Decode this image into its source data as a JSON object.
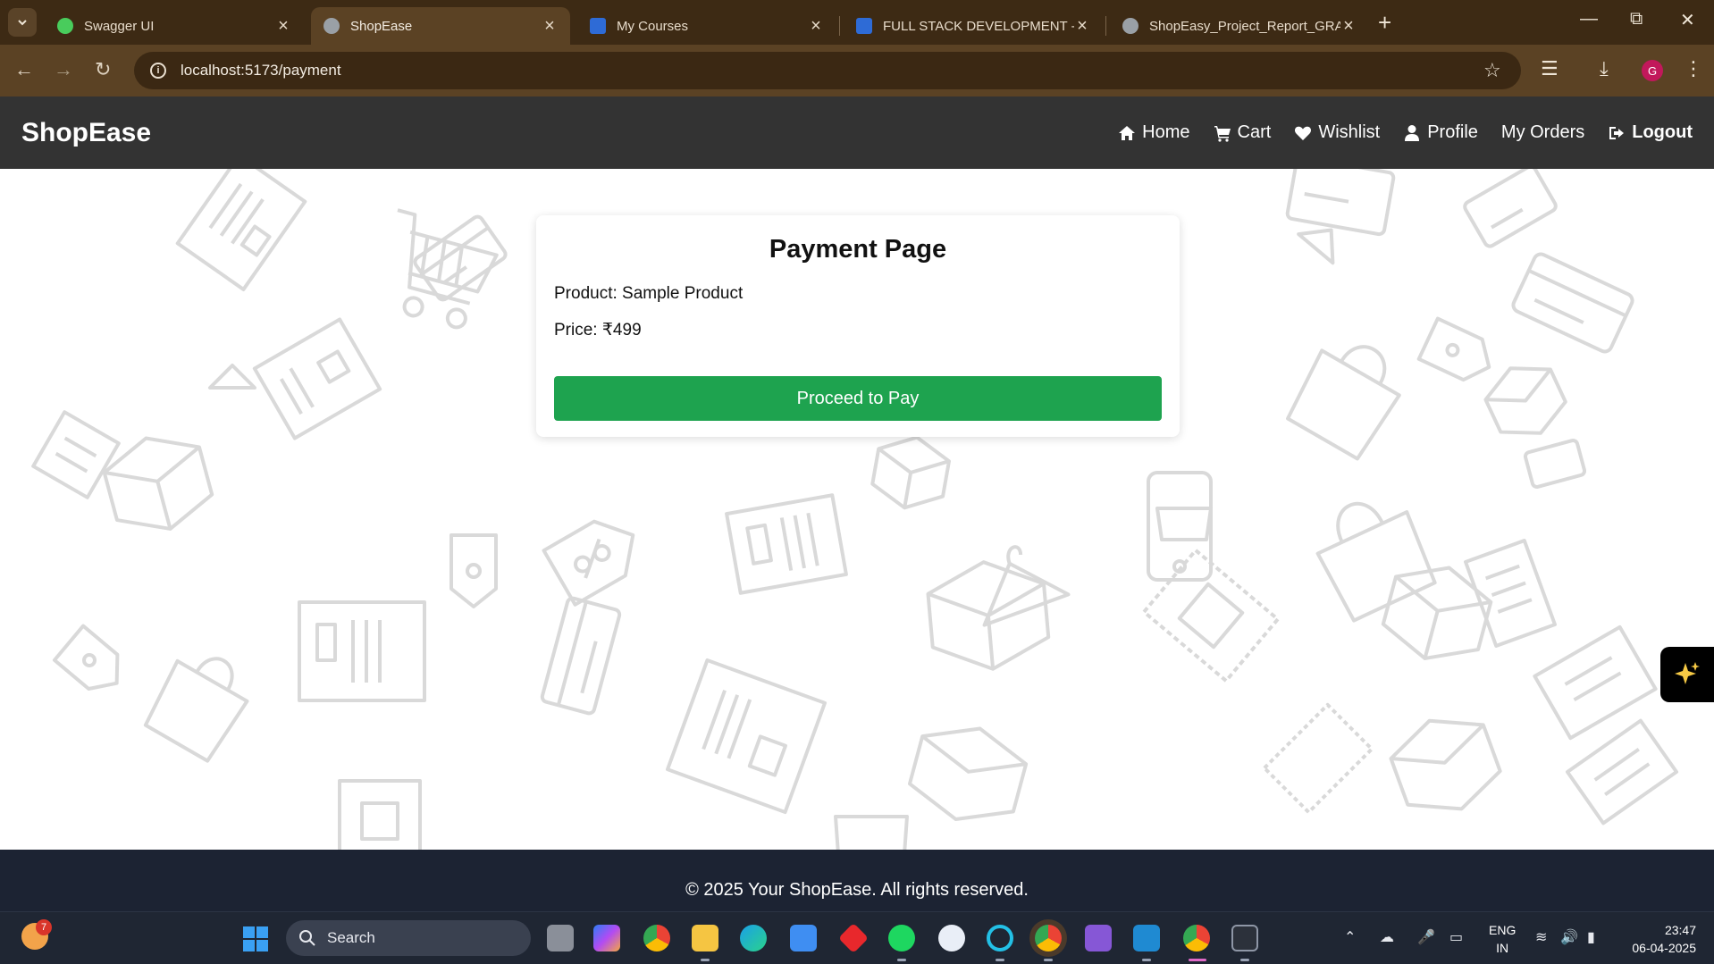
{
  "browser": {
    "tabs": [
      {
        "title": "Swagger UI",
        "active": false,
        "favicon_color": "#49cc5c"
      },
      {
        "title": "ShopEase",
        "active": true,
        "favicon_color": "#9aa0a6"
      },
      {
        "title": "My Courses",
        "active": false,
        "favicon_color": "#2e6bd6"
      },
      {
        "title": "FULL STACK DEVELOPMENT - C",
        "active": false,
        "favicon_color": "#2e6bd6"
      },
      {
        "title": "ShopEasy_Project_Report_GRAC",
        "active": false,
        "favicon_color": "#9aa0a6"
      }
    ],
    "url": "localhost:5173/payment",
    "profile_initial": "G"
  },
  "navbar": {
    "brand": "ShopEase",
    "links": [
      {
        "label": "Home",
        "icon": "home-icon"
      },
      {
        "label": "Cart",
        "icon": "cart-icon"
      },
      {
        "label": "Wishlist",
        "icon": "heart-icon"
      },
      {
        "label": "Profile",
        "icon": "user-icon"
      },
      {
        "label": "My Orders",
        "icon": ""
      },
      {
        "label": "Logout",
        "icon": "logout-icon"
      }
    ]
  },
  "payment": {
    "title": "Payment Page",
    "product_line": "Product: Sample Product",
    "price_line": "Price: ₹499",
    "button_label": "Proceed to Pay"
  },
  "footer": {
    "text": "© 2025 Your ShopEase. All rights reserved."
  },
  "taskbar": {
    "search_label": "Search",
    "weather_badge": "7",
    "lang_line1": "ENG",
    "lang_line2": "IN",
    "time": "23:47",
    "date": "06-04-2025"
  },
  "colors": {
    "navbar_bg": "#333333",
    "pay_button": "#1ea34f",
    "footer_bg": "#1c2333"
  }
}
